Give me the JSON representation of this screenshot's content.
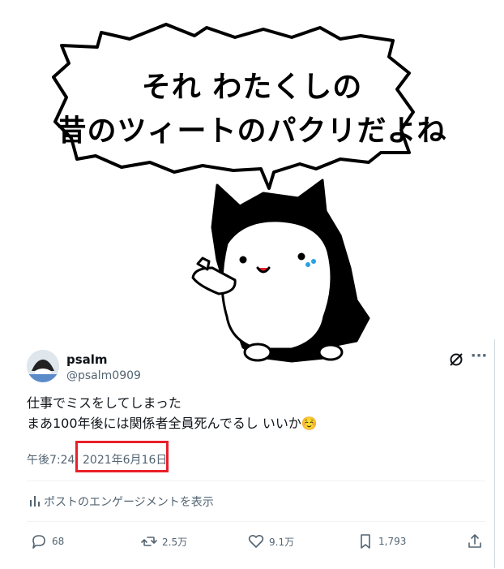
{
  "illustration": {
    "bubble_line1": "それ わたくしの",
    "bubble_line2": "昔のツィートのパクリだよね"
  },
  "post": {
    "display_name": "psalm",
    "handle": "@psalm0909",
    "text_line1": "仕事でミスをしてしまった",
    "text_line2": "まあ100年後には関係者全員死んでるし いいか☺️",
    "time": "午後7:24",
    "date": "2021年6月16日",
    "engagement_label": "ポストのエンゲージメントを表示"
  },
  "actions": {
    "replies": "68",
    "reposts": "2.5万",
    "likes": "9.1万",
    "bookmarks": "1,793"
  },
  "colors": {
    "secondary_text": "#536471",
    "highlight": "#e8202a",
    "divider": "#eff3f4"
  }
}
